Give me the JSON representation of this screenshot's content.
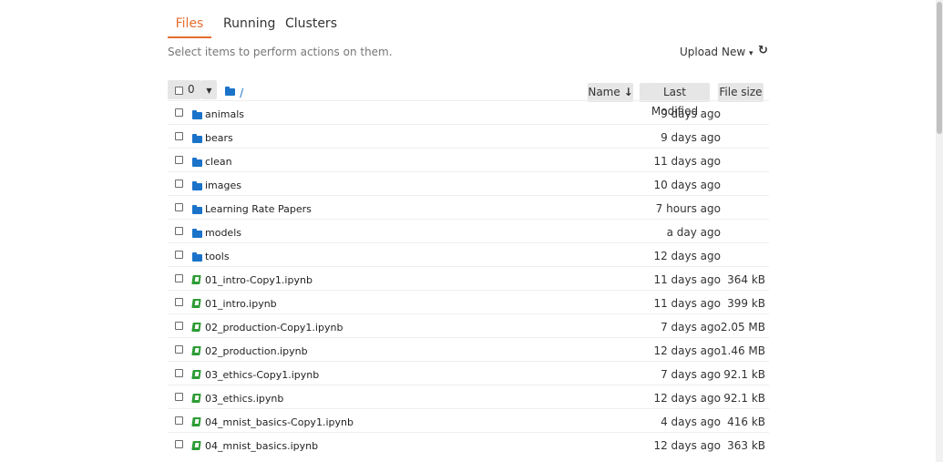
{
  "tabs": [
    {
      "label": "Files",
      "active": true
    },
    {
      "label": "Running",
      "active": false
    },
    {
      "label": "Clusters",
      "active": false
    }
  ],
  "hint": "Select items to perform actions on them.",
  "toolbar": {
    "upload_label": "Upload",
    "new_label": "New",
    "new_caret": "▾",
    "refresh_icon": "↻"
  },
  "list_header": {
    "selected_count": "0",
    "breadcrumb": "/",
    "sort_name": "Name",
    "sort_arrow": "↓",
    "last_modified": "Last Modified",
    "file_size": "File size"
  },
  "items": [
    {
      "type": "folder",
      "name": "animals",
      "modified": "9 days ago",
      "size": ""
    },
    {
      "type": "folder",
      "name": "bears",
      "modified": "9 days ago",
      "size": ""
    },
    {
      "type": "folder",
      "name": "clean",
      "modified": "11 days ago",
      "size": ""
    },
    {
      "type": "folder",
      "name": "images",
      "modified": "10 days ago",
      "size": ""
    },
    {
      "type": "folder",
      "name": "Learning Rate Papers",
      "modified": "7 hours ago",
      "size": ""
    },
    {
      "type": "folder",
      "name": "models",
      "modified": "a day ago",
      "size": ""
    },
    {
      "type": "folder",
      "name": "tools",
      "modified": "12 days ago",
      "size": ""
    },
    {
      "type": "notebook",
      "name": "01_intro-Copy1.ipynb",
      "modified": "11 days ago",
      "size": "364 kB"
    },
    {
      "type": "notebook",
      "name": "01_intro.ipynb",
      "modified": "11 days ago",
      "size": "399 kB"
    },
    {
      "type": "notebook",
      "name": "02_production-Copy1.ipynb",
      "modified": "7 days ago",
      "size": "2.05 MB"
    },
    {
      "type": "notebook",
      "name": "02_production.ipynb",
      "modified": "12 days ago",
      "size": "1.46 MB"
    },
    {
      "type": "notebook",
      "name": "03_ethics-Copy1.ipynb",
      "modified": "7 days ago",
      "size": "92.1 kB"
    },
    {
      "type": "notebook",
      "name": "03_ethics.ipynb",
      "modified": "12 days ago",
      "size": "92.1 kB"
    },
    {
      "type": "notebook",
      "name": "04_mnist_basics-Copy1.ipynb",
      "modified": "4 days ago",
      "size": "416 kB"
    },
    {
      "type": "notebook",
      "name": "04_mnist_basics.ipynb",
      "modified": "12 days ago",
      "size": "363 kB"
    }
  ],
  "colors": {
    "accent": "#e46e2e",
    "folder": "#1a73c9",
    "notebook": "#2c9c34"
  }
}
